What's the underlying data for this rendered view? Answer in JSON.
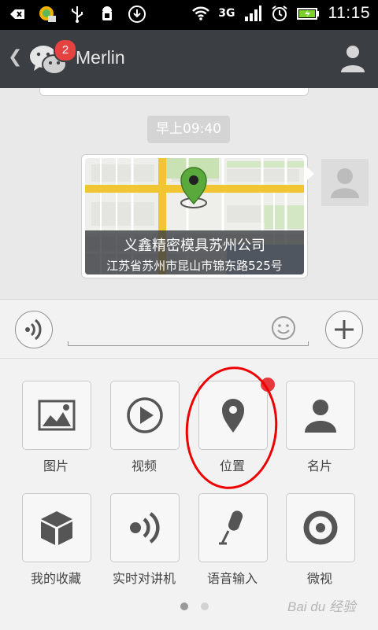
{
  "status_bar": {
    "time": "11:15",
    "network": "3G",
    "icons": [
      "back-icon",
      "notification-icon",
      "usb-icon",
      "android-debug-icon",
      "download-icon",
      "wifi-icon",
      "signal-icon",
      "alarm-icon",
      "battery-icon"
    ]
  },
  "titlebar": {
    "back_icon": "chevron-left-icon",
    "unread_count": "2",
    "title": "Merlin",
    "profile_icon": "person-icon"
  },
  "chat": {
    "timestamp": "早上09:40",
    "location_message": {
      "place_name": "义鑫精密模具苏州公司",
      "address": "江苏省苏州市昆山市锦东路525号"
    }
  },
  "input_bar": {
    "voice_icon": "voice-icon",
    "emoji_icon": "emoji-icon",
    "plus_icon": "plus-icon"
  },
  "panel": {
    "items": [
      {
        "label": "图片",
        "icon": "image-icon"
      },
      {
        "label": "视频",
        "icon": "video-icon"
      },
      {
        "label": "位置",
        "icon": "location-pin-icon"
      },
      {
        "label": "名片",
        "icon": "contact-card-icon"
      },
      {
        "label": "我的收藏",
        "icon": "cube-icon"
      },
      {
        "label": "实时对讲机",
        "icon": "walkie-talkie-icon"
      },
      {
        "label": "语音输入",
        "icon": "microphone-icon"
      },
      {
        "label": "微视",
        "icon": "camera-icon"
      }
    ],
    "page": 1,
    "pages": 2
  },
  "watermark": "Bai du 经验",
  "colors": {
    "titlebar": "#3b3e43",
    "badge": "#e64340",
    "annotation": "#e00000",
    "road": "#f2c633",
    "pin": "#5aa93c"
  }
}
